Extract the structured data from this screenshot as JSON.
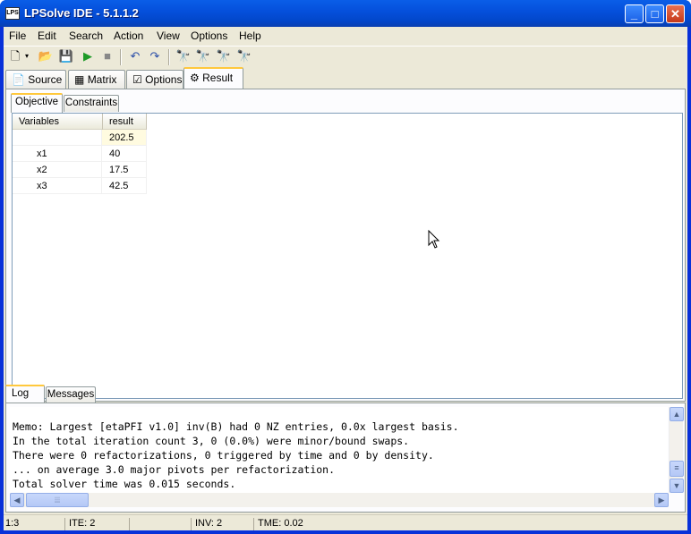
{
  "window": {
    "title": "LPSolve IDE - 5.1.1.2",
    "icon_text": "LPS"
  },
  "menu": [
    "File",
    "Edit",
    "Search",
    "Action",
    "View",
    "Options",
    "Help"
  ],
  "toolbar_icons": [
    "new-icon",
    "open-icon",
    "save-icon",
    "run-icon",
    "stop-icon",
    "undo-icon",
    "redo-icon",
    "find-icon",
    "find-next-icon",
    "find-prev-icon",
    "replace-icon"
  ],
  "main_tabs": [
    "Source",
    "Matrix",
    "Options",
    "Result"
  ],
  "result_tabs": [
    "Objective",
    "Constraints"
  ],
  "grid": {
    "headers": [
      "Variables",
      "result"
    ],
    "rows": [
      {
        "name": "",
        "value": "202.5"
      },
      {
        "name": "x1",
        "value": "40"
      },
      {
        "name": "x2",
        "value": "17.5"
      },
      {
        "name": "x3",
        "value": "42.5"
      }
    ]
  },
  "log_tabs": [
    "Log",
    "Messages"
  ],
  "log_lines": [
    "Memo: Largest [etaPFI v1.0] inv(B) had 0 NZ entries, 0.0x largest basis.",
    "In the total iteration count 3, 0 (0.0%) were minor/bound swaps.",
    "There were 0 refactorizations, 0 triggered by time and 0 by density.",
    "... on average 3.0 major pivots per refactorization.",
    "Total solver time was 0.015 seconds."
  ],
  "status": [
    "1:3",
    "ITE: 2",
    "",
    "INV: 2",
    "TME: 0.02"
  ]
}
